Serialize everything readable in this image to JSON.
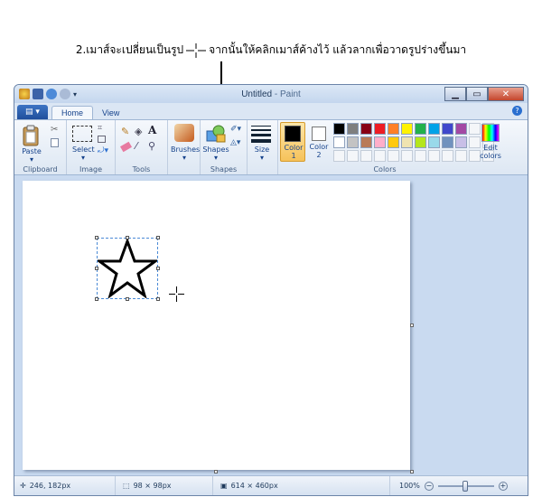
{
  "annotation": {
    "prefix": "2.เมาส์จะเปลี่ยนเป็นรูป",
    "suffix": "จากนั้นให้คลิกเมาส์ค้างไว้ แล้วลากเพื่อวาดรูปร่างขึ้นมา"
  },
  "window": {
    "title_doc": "Untitled",
    "title_sep": " - ",
    "title_app": "Paint"
  },
  "tabs": {
    "home": "Home",
    "view": "View"
  },
  "ribbon": {
    "clipboard": {
      "paste": "Paste",
      "group": "Clipboard"
    },
    "image": {
      "select": "Select",
      "group": "Image"
    },
    "tools": {
      "group": "Tools"
    },
    "brushes": {
      "label": "Brushes"
    },
    "shapes": {
      "label": "Shapes",
      "group": "Shapes"
    },
    "size": {
      "label": "Size"
    },
    "color1": {
      "label": "Color",
      "num": "1"
    },
    "color2": {
      "label": "Color",
      "num": "2"
    },
    "colors": {
      "group": "Colors"
    },
    "edit_colors": {
      "line1": "Edit",
      "line2": "colors"
    }
  },
  "palette": [
    "#000000",
    "#7f7f7f",
    "#880015",
    "#ed1c24",
    "#ff7f27",
    "#fff200",
    "#22b14c",
    "#00a2e8",
    "#3f48cc",
    "#a349a4",
    "",
    "",
    "#ffffff",
    "#c3c3c3",
    "#b97a57",
    "#ffaec9",
    "#ffc90e",
    "#efe4b0",
    "#b5e61d",
    "#99d9ea",
    "#7092be",
    "#c8bfe7",
    "",
    "",
    "",
    "",
    "",
    "",
    "",
    "",
    "",
    "",
    "",
    "",
    "",
    ""
  ],
  "colors": {
    "color1": "#000000",
    "color2": "#ffffff",
    "accent": "#1e395b"
  },
  "status": {
    "cursor_pos": "246, 182px",
    "selection_size": "98 × 98px",
    "image_size": "614 × 460px",
    "zoom": "100%"
  }
}
